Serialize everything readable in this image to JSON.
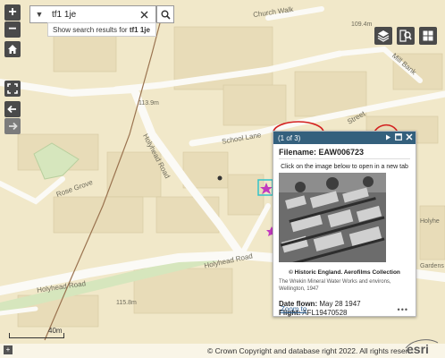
{
  "search": {
    "value": "tf1 1je",
    "suggestion_prefix": "Show search results for ",
    "suggestion_term": "tf1 1je"
  },
  "map": {
    "streets": [
      {
        "label": "Church Walk"
      },
      {
        "label": "Mill Bank"
      },
      {
        "label": "School Lane"
      },
      {
        "label": "Holyhead Road"
      },
      {
        "label": "Holyhead Road"
      },
      {
        "label": "Holyhead Road"
      },
      {
        "label": "Rose Grove"
      },
      {
        "label": "Street"
      },
      {
        "label": "Holyhe"
      },
      {
        "label": "Gardens"
      }
    ],
    "elevations": [
      "109.4m",
      "113.9m",
      "115.8m"
    ],
    "scale_label": "40m"
  },
  "popup": {
    "counter": "(1 of 3)",
    "filename_label": "Filename: EAW006723",
    "instruction": "Click on the image below to open in a new tab",
    "credit": "© Historic England. Aerofilms Collection",
    "caption": "The Wrekin Mineral Water Works and environs, Wellington, 1947",
    "date_label": "Date flown:",
    "date_value": "May 28 1947",
    "flight_label": "Flight:",
    "flight_value": "AFL19470528",
    "zoom_label": "Zoom to",
    "more_label": "•••"
  },
  "attribution": "© Crown Copyright and database right 2022. All rights reser...",
  "logo": "esri",
  "colors": {
    "map_bg": "#f1e8c9",
    "road": "#fbfaf6",
    "building": "#e4d8b4",
    "park": "#cfe3b5",
    "popup_header": "#34607d",
    "control_bg": "#4a4a4a",
    "annotation_red": "#d3201f",
    "marker_magenta": "#c23abf",
    "highlight_cyan": "#34c3c9"
  }
}
